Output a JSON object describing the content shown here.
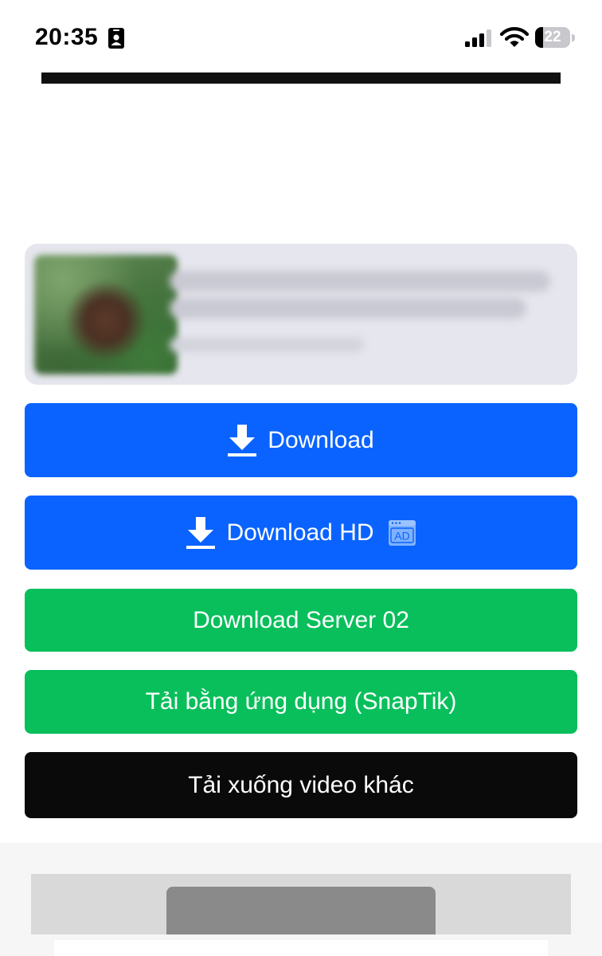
{
  "status_bar": {
    "time": "20:35",
    "battery_level": "22",
    "battery_fraction": 0.22
  },
  "icons": {
    "contact": "contact-card-icon",
    "signal": "cellular-signal-icon",
    "wifi": "wifi-icon",
    "download": "download-icon",
    "ad": "ad-badge-icon"
  },
  "ad_badge_text": "AD",
  "buttons": {
    "download": "Download",
    "download_hd": "Download HD",
    "server_02": "Download Server 02",
    "app_download": "Tải bằng ứng dụng (SnapTik)",
    "other_video": "Tải xuống video khác"
  },
  "colors": {
    "primary_blue": "#0a63ff",
    "success_green": "#08bf5b",
    "dark": "#0a0a0a",
    "card_background": "#e6e6ee"
  }
}
